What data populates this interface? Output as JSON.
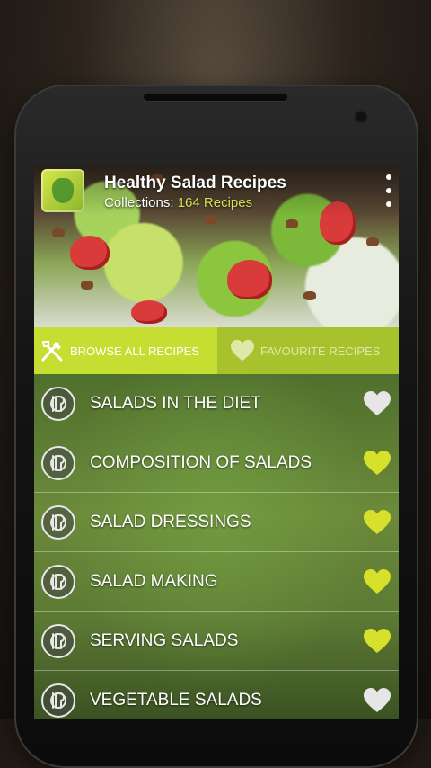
{
  "app": {
    "title": "Healthy Salad Recipes",
    "subtitle_prefix": "Collections: ",
    "subtitle_count": "164 Recipes"
  },
  "tabs": [
    {
      "label": "BROWSE ALL RECIPES",
      "icon": "fork-knife-icon",
      "selected": true
    },
    {
      "label": "FAVOURITE RECIPES",
      "icon": "heart-icon",
      "selected": false
    }
  ],
  "items": [
    {
      "label": "SALADS IN THE DIET",
      "favourite": false
    },
    {
      "label": "COMPOSITION OF SALADS",
      "favourite": true
    },
    {
      "label": "SALAD DRESSINGS",
      "favourite": true
    },
    {
      "label": "SALAD MAKING",
      "favourite": true
    },
    {
      "label": "SERVING SALADS",
      "favourite": true
    },
    {
      "label": "VEGETABLE SALADS",
      "favourite": false
    }
  ],
  "colors": {
    "accent": "#c6dd31",
    "heart_on": "#d7e02a",
    "heart_off": "#e6e6e6"
  }
}
